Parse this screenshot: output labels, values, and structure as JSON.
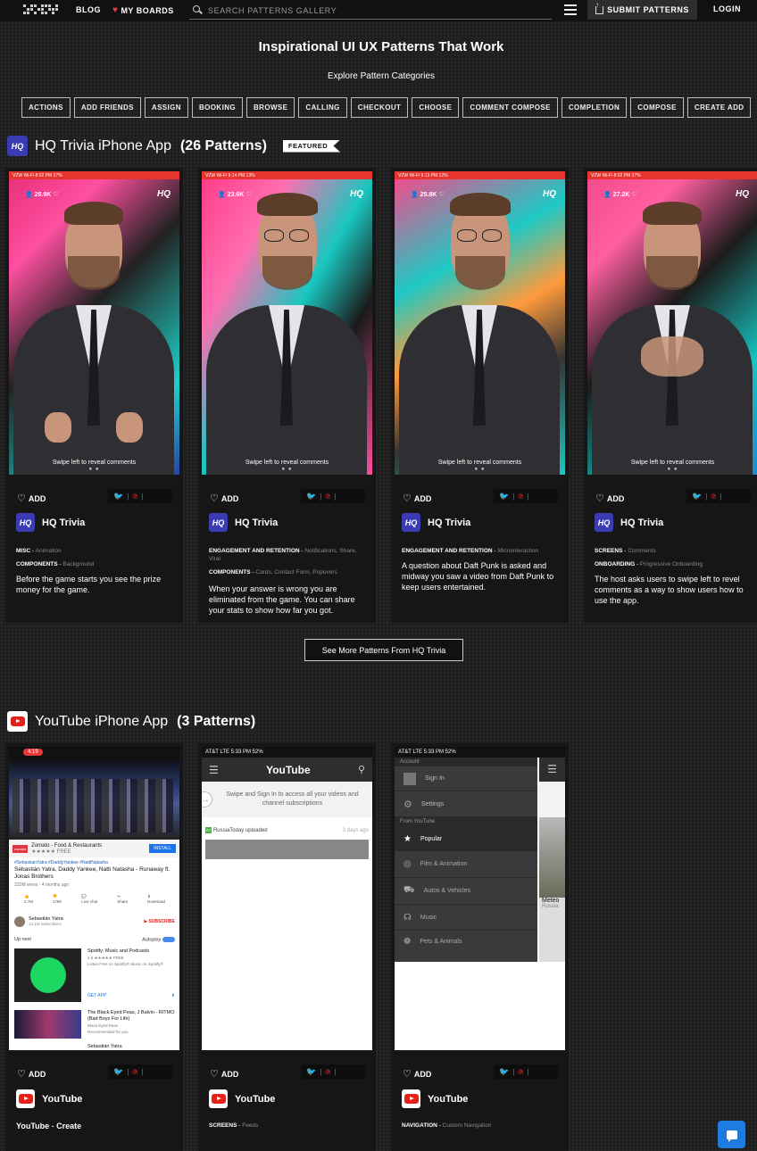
{
  "nav": {
    "blog": "BLOG",
    "boards": "MY BOARDS",
    "search_placeholder": "SEARCH PATTERNS GALLERY",
    "submit": "SUBMIT PATTERNS",
    "login": "LOGIN"
  },
  "hero": {
    "title": "Inspirational UI UX Patterns That Work",
    "subtitle": "Explore Pattern Categories"
  },
  "categories": [
    "ACTIONS",
    "ADD FRIENDS",
    "ASSIGN",
    "BOOKING",
    "BROWSE",
    "CALLING",
    "CHECKOUT",
    "CHOOSE",
    "COMMENT COMPOSE",
    "COMPLETION",
    "COMPOSE",
    "CREATE ADD"
  ],
  "hq": {
    "logo": "HQ",
    "name": "HQ Trivia iPhone App",
    "count": "(26 Patterns)",
    "featured": "FEATURED",
    "more": "See More Patterns From HQ Trivia",
    "swipe": "Swipe left to reveal comments",
    "cards": [
      {
        "status": "VZW Wi-Fi   8:02 PM   37%",
        "viewers": "26.9K",
        "add": "ADD",
        "app": "HQ Trivia",
        "tag1_key": "MISC",
        "tag1_val": "Animation",
        "tag2_key": "COMPONENTS",
        "tag2_val": "Background",
        "desc": "Before the game starts you see the prize money for the game."
      },
      {
        "status": "VZW Wi-Fi   9:14 PM   13%",
        "viewers": "23.6K",
        "add": "ADD",
        "app": "HQ Trivia",
        "tag1_key": "ENGAGEMENT AND RETENTION",
        "tag1_val": "Notifications, Share, Viral",
        "tag2_key": "COMPONENTS",
        "tag2_val": "Cards, Contact Form, Popovers",
        "desc": "When your answer is wrong you are eliminated from the game. You can share your stats to show how far you got."
      },
      {
        "status": "VZW Wi-Fi   9:13 PM   12%",
        "viewers": "25.8K",
        "add": "ADD",
        "app": "HQ Trivia",
        "tag1_key": "ENGAGEMENT AND RETENTION",
        "tag1_val": "Microinteraction",
        "tag2_key": "",
        "tag2_val": "",
        "desc": "A question about Daft Punk is asked and midway you saw a video from Daft Punk to keep users entertained."
      },
      {
        "status": "VZW Wi-Fi   8:02 PM   37%",
        "viewers": "27.2K",
        "add": "ADD",
        "app": "HQ Trivia",
        "tag1_key": "SCREENS",
        "tag1_val": "Comments",
        "tag2_key": "ONBOARDING",
        "tag2_val": "Progressive Onboarding",
        "desc": "The host asks users to swipe left to revel comments as a way to show users how to use the app."
      }
    ]
  },
  "yt": {
    "name": "YouTube iPhone App",
    "count": "(3 Patterns)",
    "cards": [
      {
        "add": "ADD",
        "app": "YouTube",
        "tag_key": "YouTube",
        "tag_val": "Create"
      },
      {
        "add": "ADD",
        "app": "YouTube",
        "tag_key": "SCREENS",
        "tag_val": "Feeds"
      },
      {
        "add": "ADD",
        "app": "YouTube",
        "tag_key": "NAVIGATION",
        "tag_val": "Custom Navigation"
      }
    ],
    "s1": {
      "time": "4:19",
      "ad_name": "Zomato - Food & Restaurants",
      "ad_meta": "★★★★★ FREE",
      "install": "INSTALL",
      "hashtags": "#SebastianYatra #DaddyYankee #NattiNatasha",
      "video_title": "Sebastián Yatra, Daddy Yankee, Natti Natasha - Runaway ft. Jonas Brothers",
      "views": "232M views · 4 months ago",
      "actions": [
        "2.7M",
        "178K",
        "Live chat",
        "Share",
        "Download"
      ],
      "channel": "Sebastián Yatra",
      "subs": "12.1M subscribers",
      "subscribe": "SUBSCRIBE",
      "up_next": "Up next",
      "autoplay": "Autoplay",
      "spotify_title": "Spotify: Music and Podcasts",
      "spotify_meta": "4.6 ★★★★★ FREE",
      "spotify_desc": "Listen Free on Spotify® Music on Spotify®",
      "get_app": "GET APP",
      "next_title": "The Black Eyed Peas, J Balvin - RITMO (Bad Boys For Life)",
      "next_channel": "Black Eyed Peas",
      "next_meta": "Recommended for you",
      "next2": "Sebastián Yatra"
    },
    "s2": {
      "status": "AT&T  LTE     5:33 PM     52%",
      "logo": "YouTube",
      "prompt": "Swipe and Sign In to access all your videos and channel subscriptions",
      "uploader": "RussiaToday uploaded",
      "ago": "3 days ago"
    },
    "s3": {
      "status": "AT&T  LTE     5:33 PM     52%",
      "account": "Account",
      "sign_in": "Sign In",
      "settings": "Settings",
      "from": "From YouTube",
      "items": [
        "Popular",
        "Film & Animation",
        "Autos & Vehicles",
        "Music",
        "Pets & Animals"
      ],
      "peek1": "Meteo",
      "peek2": "Russia"
    }
  }
}
